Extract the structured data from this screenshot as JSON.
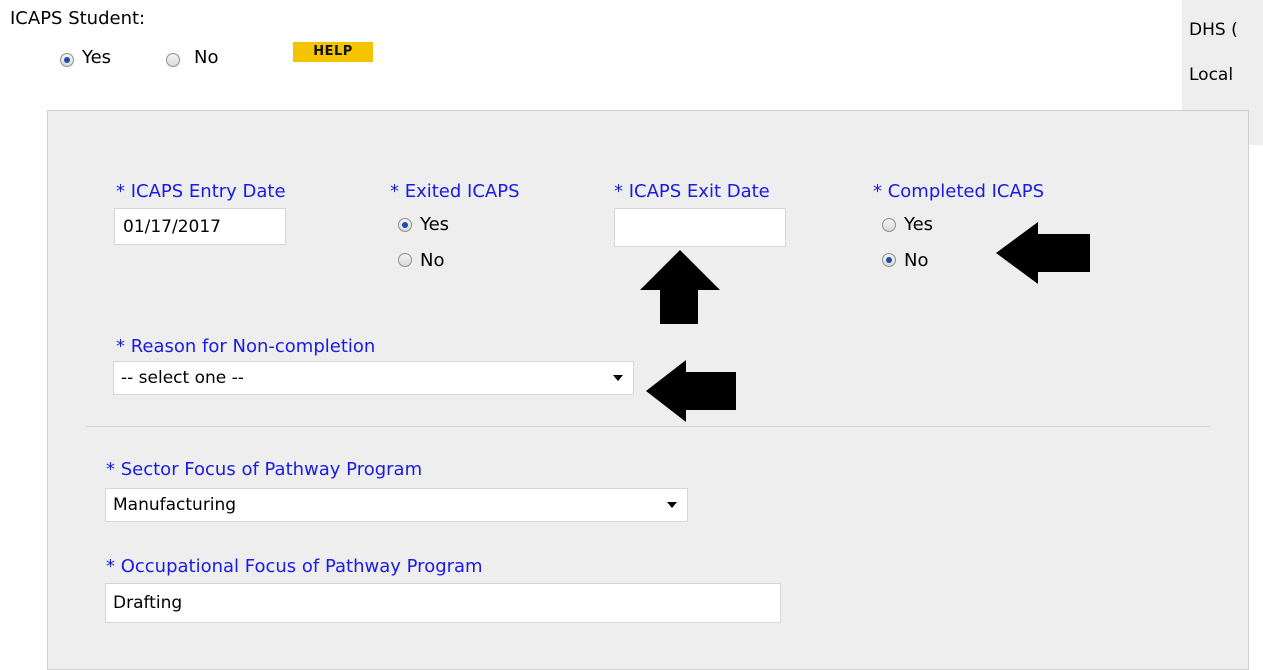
{
  "icaps_student": {
    "label": "ICAPS Student:",
    "options": [
      {
        "label": "Yes",
        "selected": true
      },
      {
        "label": "No",
        "selected": false
      }
    ],
    "help_label": "HELP"
  },
  "side_panel": {
    "line1": "DHS (",
    "line2": "Local"
  },
  "form": {
    "entry_date": {
      "label": "* ICAPS Entry Date",
      "value": "01/17/2017"
    },
    "exited": {
      "label": "* Exited ICAPS",
      "options": [
        {
          "label": "Yes",
          "selected": true
        },
        {
          "label": "No",
          "selected": false
        }
      ]
    },
    "exit_date": {
      "label": "* ICAPS Exit Date",
      "value": ""
    },
    "completed": {
      "label": "* Completed ICAPS",
      "options": [
        {
          "label": "Yes",
          "selected": false
        },
        {
          "label": "No",
          "selected": true
        }
      ]
    },
    "reason": {
      "label": "* Reason for Non-completion",
      "value": "-- select one --"
    },
    "sector": {
      "label": "* Sector Focus of Pathway Program",
      "value": "Manufacturing"
    },
    "occupational": {
      "label": "* Occupational Focus of Pathway Program",
      "value": "Drafting"
    }
  },
  "colors": {
    "label_blue": "#1a1ae6",
    "panel_bg": "#eeeeee",
    "help_bg": "#f5c400",
    "annotation_arrow": "#000000"
  }
}
